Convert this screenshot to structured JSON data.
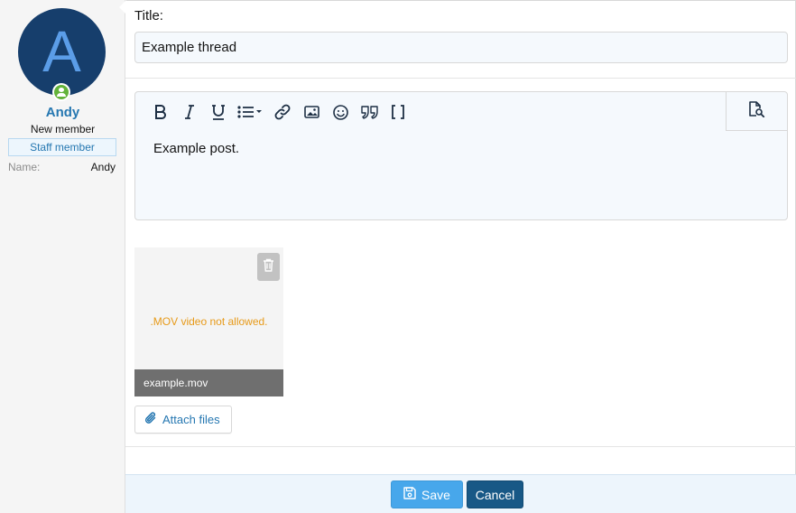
{
  "user": {
    "avatar_letter": "A",
    "name": "Andy",
    "title": "New member",
    "banner": "Staff member",
    "field_label": "Name:",
    "field_value": "Andy",
    "online": true
  },
  "form": {
    "title_label": "Title:",
    "title_value": "Example thread",
    "editor_content": "Example post."
  },
  "toolbar": {
    "buttons": [
      "bold-icon",
      "italic-icon",
      "underline-icon",
      "list-icon",
      "link-icon",
      "image-icon",
      "smilie-icon",
      "quote-icon",
      "bbcode-icon"
    ],
    "preview": "preview-icon"
  },
  "attachment": {
    "error": ".MOV video not allowed.",
    "filename": "example.mov"
  },
  "buttons": {
    "attach_files": "Attach files",
    "save": "Save",
    "cancel": "Cancel"
  },
  "colors": {
    "accent": "#2577b1",
    "save": "#47a7eb",
    "cancel": "#185886",
    "error": "#e79a19",
    "online": "#63b33a",
    "avatar_bg": "#163e6c"
  }
}
